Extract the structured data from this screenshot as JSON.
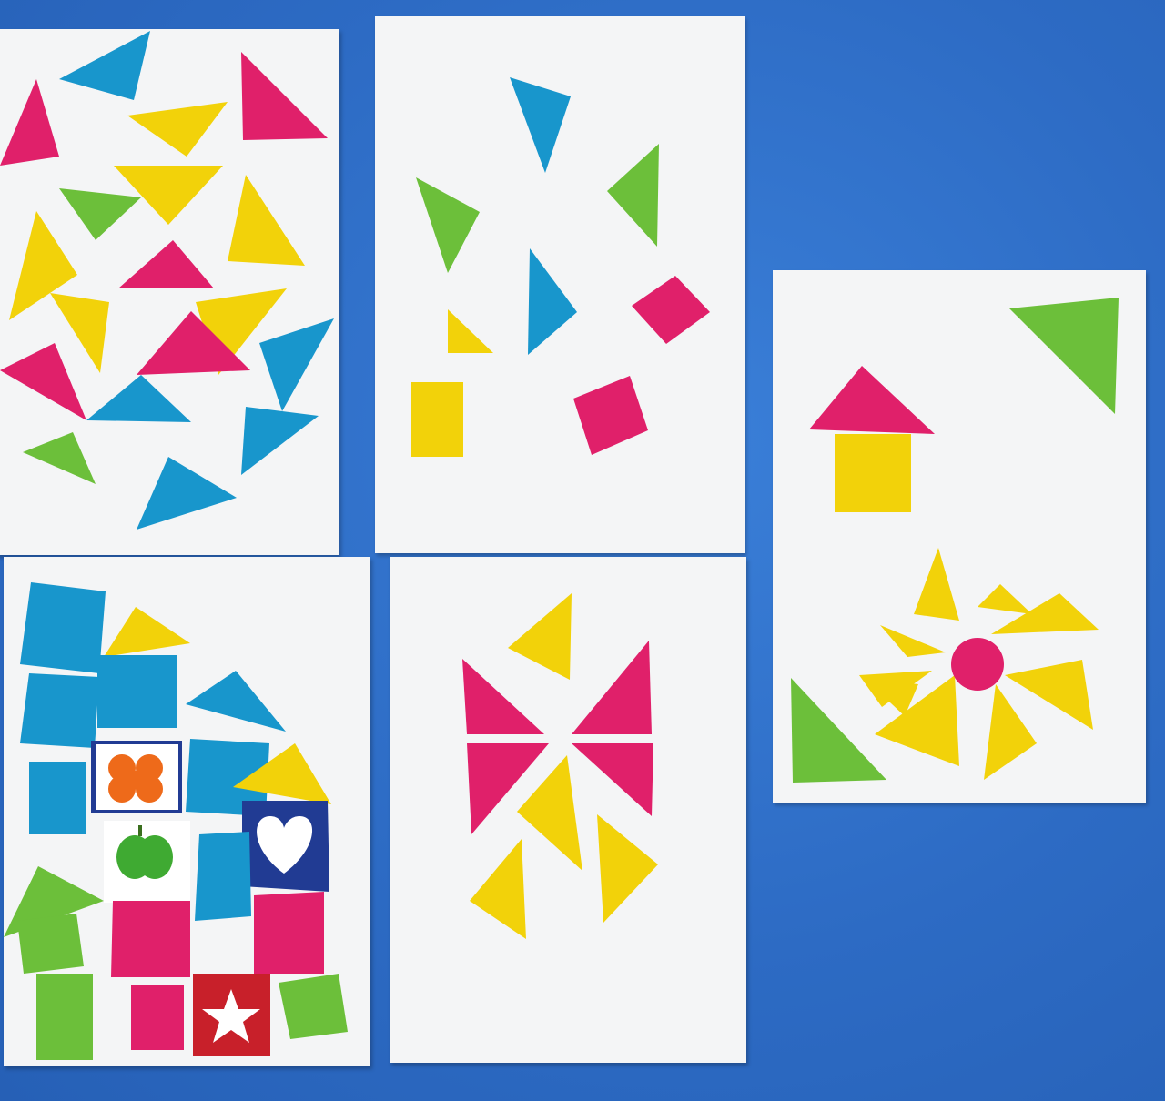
{
  "scene": {
    "subject": "paper-collage-cards",
    "colors": {
      "background": "#2f6fc9",
      "paper": "#f4f5f6",
      "pink": "#e0206a",
      "yellow": "#f2d20a",
      "blue": "#1896cc",
      "green": "#6cbf3a",
      "orange": "#ee6a1a",
      "navy": "#213b93",
      "red": "#c8202a"
    }
  },
  "cards": [
    {
      "id": "card-triangles-scatter",
      "content": "mosaic-of-triangles"
    },
    {
      "id": "card-sparse-shapes",
      "content": "sparse-triangles-and-squares"
    },
    {
      "id": "card-house-and-flower",
      "content": "house-and-sun-flower"
    },
    {
      "id": "card-block-house",
      "content": "house-of-squares-with-stickers"
    },
    {
      "id": "card-butterfly",
      "content": "butterfly-of-triangles"
    }
  ]
}
